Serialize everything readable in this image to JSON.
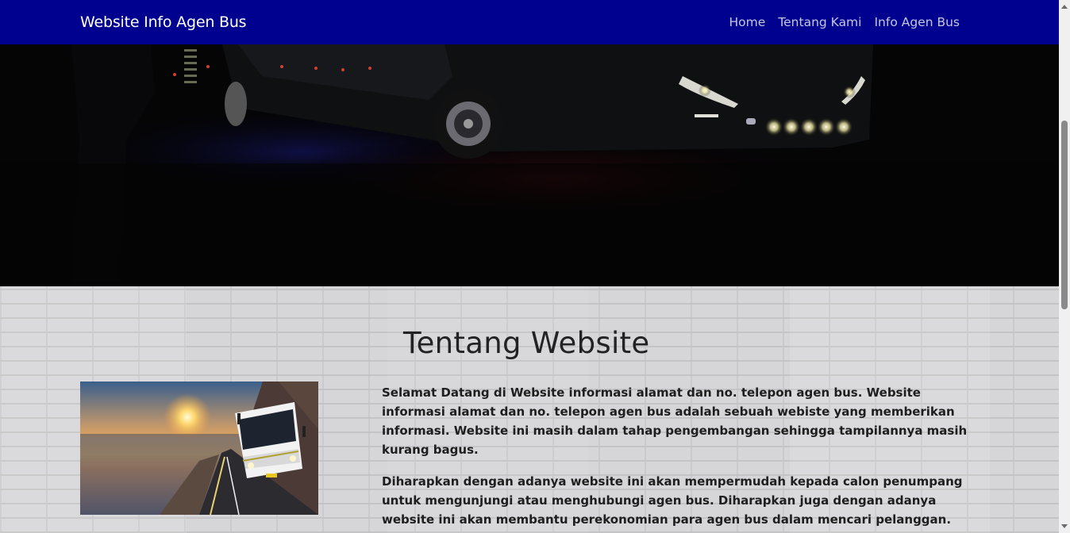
{
  "navbar": {
    "brand": "Website Info Agen Bus",
    "links": [
      "Home",
      "Tentang Kami",
      "Info Agen Bus"
    ]
  },
  "hero": {
    "image": "bus-at-night-photo"
  },
  "about": {
    "title": "Tentang Website",
    "image": "bus-on-coastal-road-sunset-photo",
    "paragraphs": [
      "Selamat Datang di Website informasi alamat dan no. telepon agen bus. Website informasi alamat dan no. telepon agen bus adalah sebuah webiste yang memberikan informasi. Website ini masih dalam tahap pengembangan sehingga tampilannya masih kurang bagus.",
      "Diharapkan dengan adanya website ini akan mempermudah kepada calon penumpang untuk mengunjungi atau menghubungi agen bus. Diharapkan juga dengan adanya website ini akan membantu perekonomian para agen bus dalam mencari pelanggan."
    ]
  },
  "colors": {
    "navbar_bg": "#010190",
    "nav_link": "#c6c6e6",
    "brand_text": "#ffffff"
  }
}
